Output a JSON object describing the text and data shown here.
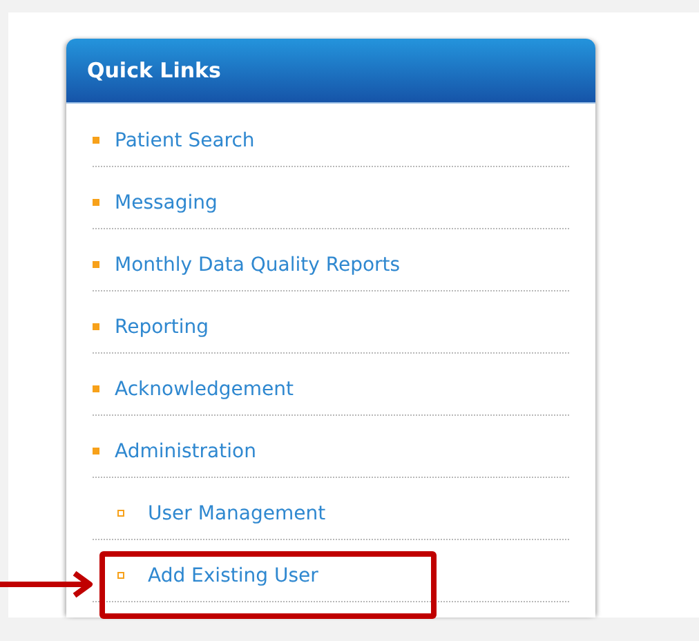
{
  "panel": {
    "title": "Quick Links",
    "items": [
      {
        "label": "Patient Search",
        "highlighted": false
      },
      {
        "label": "Messaging",
        "highlighted": false
      },
      {
        "label": "Monthly Data Quality Reports",
        "highlighted": false
      },
      {
        "label": "Reporting",
        "highlighted": false
      },
      {
        "label": "Acknowledgement",
        "highlighted": false
      },
      {
        "label": "Administration",
        "highlighted": false,
        "children": [
          {
            "label": "User Management",
            "highlighted": false
          },
          {
            "label": "Add Existing User",
            "highlighted": true
          }
        ]
      }
    ]
  }
}
